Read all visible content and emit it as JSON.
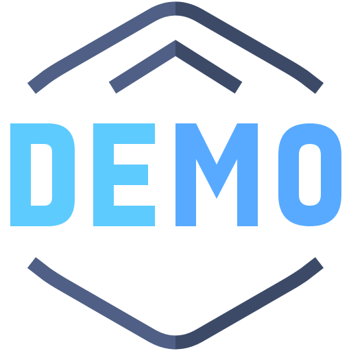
{
  "logo": {
    "letters": [
      "D",
      "E",
      "M",
      "O"
    ],
    "colors": {
      "frame_left": "#4f5f85",
      "frame_right": "#3c4a68",
      "letters_light": "#5ecbff",
      "letters_dark": "#57aaff"
    },
    "icons": {
      "frame": "hexagon-frame-icon",
      "chevron": "chevron-up-icon"
    }
  }
}
